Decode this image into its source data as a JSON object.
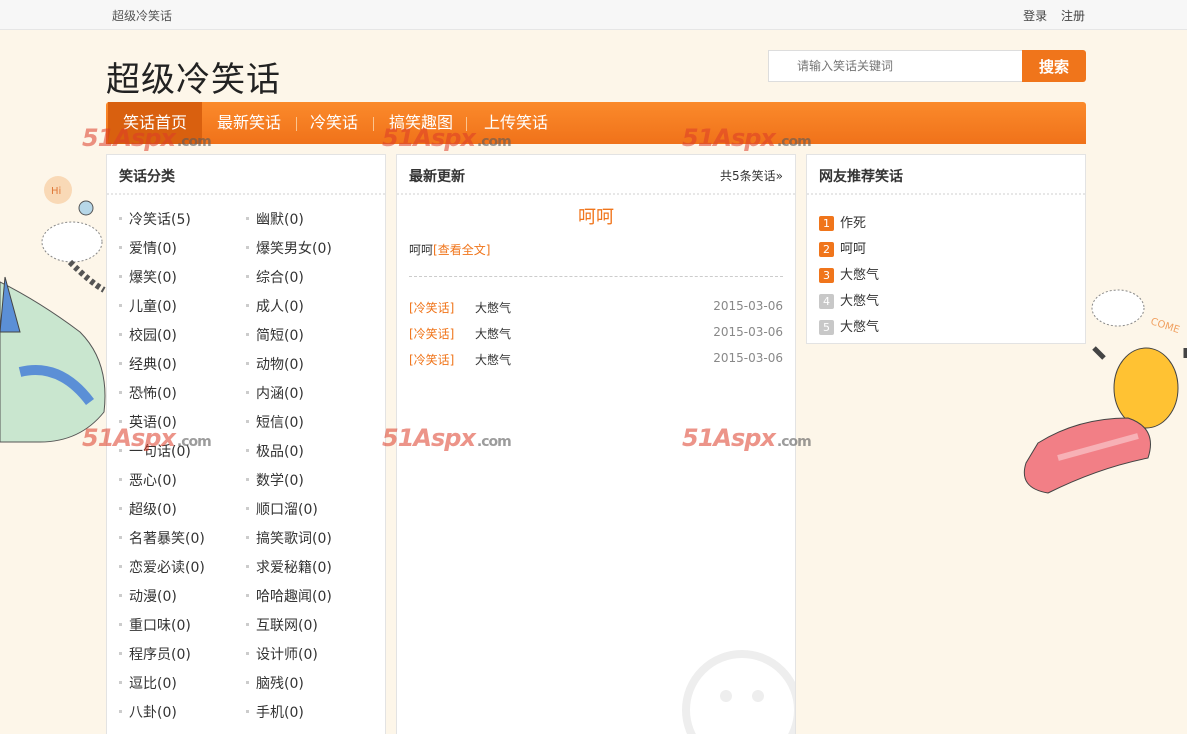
{
  "topbar": {
    "site_name": "超级冷笑话",
    "login": "登录",
    "register": "注册"
  },
  "header": {
    "logo": "超级冷笑话",
    "search_placeholder": "请输入笑话关键词",
    "search_button": "搜索"
  },
  "nav": {
    "items": [
      {
        "label": "笑话首页",
        "active": true
      },
      {
        "label": "最新笑话",
        "active": false
      },
      {
        "label": "冷笑话",
        "active": false
      },
      {
        "label": "搞笑趣图",
        "active": false
      },
      {
        "label": "上传笑话",
        "active": false
      }
    ]
  },
  "watermark": {
    "main": "51Aspx",
    "suffix": ".com"
  },
  "categories": {
    "title": "笑话分类",
    "items": [
      "冷笑话(5)",
      "幽默(0)",
      "爱情(0)",
      "爆笑男女(0)",
      "爆笑(0)",
      "综合(0)",
      "儿童(0)",
      "成人(0)",
      "校园(0)",
      "简短(0)",
      "经典(0)",
      "动物(0)",
      "恐怖(0)",
      "内涵(0)",
      "英语(0)",
      "短信(0)",
      "一句话(0)",
      "极品(0)",
      "恶心(0)",
      "数学(0)",
      "超级(0)",
      "顺口溜(0)",
      "名著暴笑(0)",
      "搞笑歌词(0)",
      "恋爱必读(0)",
      "求爱秘籍(0)",
      "动漫(0)",
      "哈哈趣闻(0)",
      "重口味(0)",
      "互联网(0)",
      "程序员(0)",
      "设计师(0)",
      "逗比(0)",
      "脑残(0)",
      "八卦(0)",
      "手机(0)"
    ]
  },
  "latest": {
    "title": "最新更新",
    "count_label": "共5条笑话»",
    "feature_title": "呵呵",
    "feature_text": "呵呵",
    "feature_link": "[查看全文]",
    "items": [
      {
        "tag": "[冷笑话]",
        "title": "大憋气",
        "date": "2015-03-06"
      },
      {
        "tag": "[冷笑话]",
        "title": "大憋气",
        "date": "2015-03-06"
      },
      {
        "tag": "[冷笑话]",
        "title": "大憋气",
        "date": "2015-03-06"
      }
    ]
  },
  "recommend": {
    "title": "网友推荐笑话",
    "items": [
      {
        "num": "1",
        "title": "作死",
        "hot": true
      },
      {
        "num": "2",
        "title": "呵呵",
        "hot": true
      },
      {
        "num": "3",
        "title": "大憋气",
        "hot": true
      },
      {
        "num": "4",
        "title": "大憋气",
        "hot": false
      },
      {
        "num": "5",
        "title": "大憋气",
        "hot": false
      }
    ]
  },
  "colors": {
    "accent": "#f0751b",
    "hot_badge": "#f0751b",
    "cool_badge": "#c8c8c8"
  },
  "decorations": {
    "bubble_text": "Hi",
    "come_text": "COME"
  }
}
